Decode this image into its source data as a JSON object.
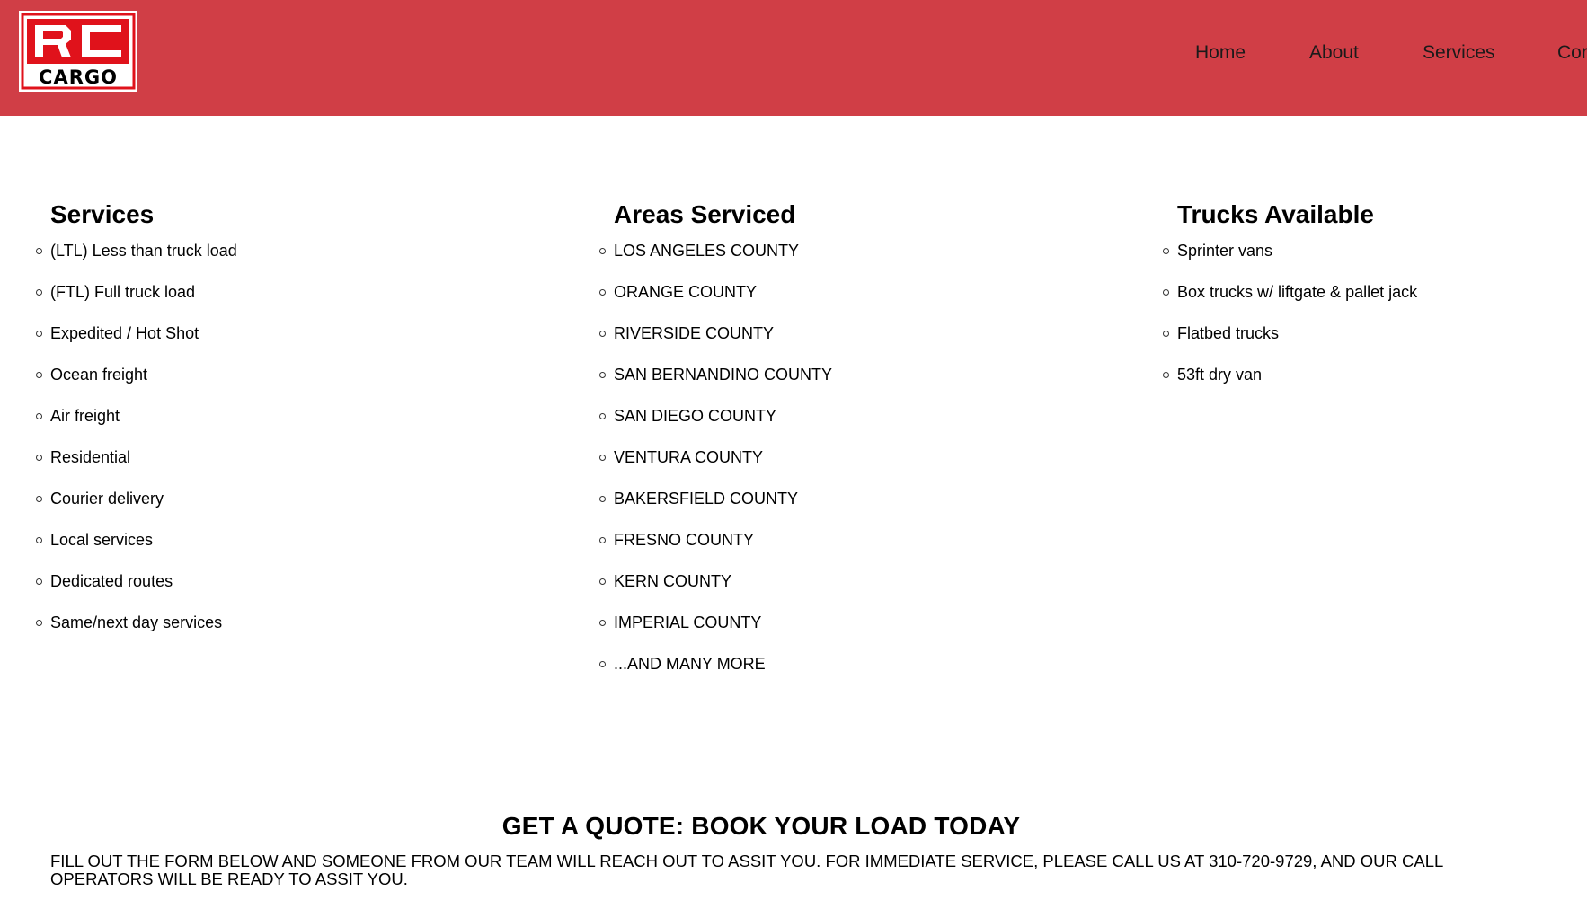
{
  "header": {
    "logo": {
      "line1": "RC",
      "line2": "CARGO"
    },
    "nav": [
      "Home",
      "About",
      "Services",
      "Cor"
    ],
    "colors": {
      "background": "#d03e46",
      "logo_red": "#e0121b"
    }
  },
  "columns": [
    {
      "title": "Services",
      "items": [
        "(LTL) Less than truck load",
        "(FTL) Full truck load",
        "Expedited / Hot Shot",
        "Ocean freight",
        "Air freight",
        "Residential",
        "Courier delivery",
        "Local services",
        "Dedicated routes",
        "Same/next day services"
      ]
    },
    {
      "title": "Areas Serviced",
      "items": [
        "LOS ANGELES COUNTY",
        "ORANGE COUNTY",
        "RIVERSIDE COUNTY",
        "SAN BERNANDINO COUNTY",
        "SAN DIEGO COUNTY",
        "VENTURA COUNTY",
        "BAKERSFIELD COUNTY",
        "FRESNO COUNTY",
        "KERN COUNTY",
        "IMPERIAL COUNTY",
        "...AND MANY MORE"
      ]
    },
    {
      "title": "Trucks Available",
      "items": [
        "Sprinter vans",
        "Box trucks w/ liftgate & pallet jack",
        "Flatbed trucks",
        "53ft dry van"
      ]
    }
  ],
  "quote": {
    "title": "GET A QUOTE: BOOK YOUR LOAD TODAY",
    "description": "FILL OUT THE FORM BELOW AND SOMEONE FROM OUR TEAM WILL REACH OUT TO ASSIT YOU. FOR IMMEDIATE SERVICE, PLEASE CALL US AT 310-720-9729, AND OUR CALL OPERATORS WILL BE READY TO ASSIT YOU."
  }
}
